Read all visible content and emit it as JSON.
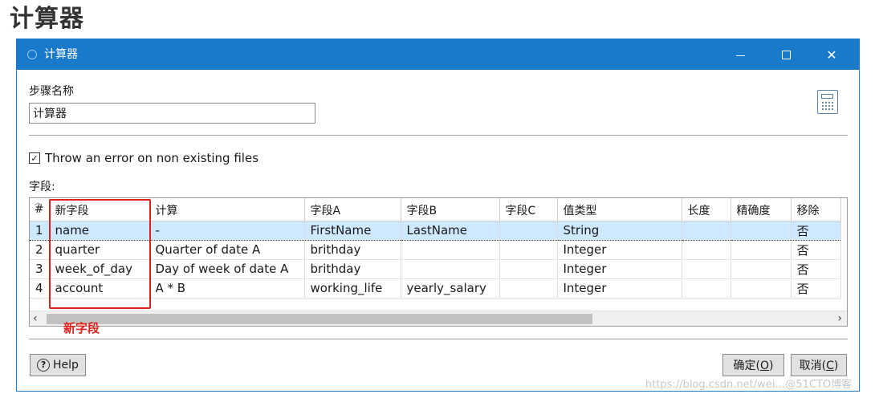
{
  "page_heading": "计算器",
  "window": {
    "title": "计算器",
    "step_name_label": "步骤名称",
    "step_name_value": "计算器",
    "calculator_icon": "calculator-icon"
  },
  "options": {
    "throw_error_label": "Throw an error on non existing files",
    "throw_error_checked": true,
    "checkmark": "✓"
  },
  "fields": {
    "label": "字段:",
    "columns": [
      "#",
      "新字段",
      "计算",
      "字段A",
      "字段B",
      "字段C",
      "值类型",
      "长度",
      "精确度",
      "移除"
    ],
    "rows": [
      [
        "1",
        "name",
        "-",
        "FirstName",
        "LastName",
        "",
        "String",
        "",
        "",
        "否"
      ],
      [
        "2",
        "quarter",
        "Quarter of date A",
        "brithday",
        "",
        "",
        "Integer",
        "",
        "",
        "否"
      ],
      [
        "3",
        "week_of_day",
        "Day of week of date A",
        "brithday",
        "",
        "",
        "Integer",
        "",
        "",
        "否"
      ],
      [
        "4",
        "account",
        "A * B",
        "working_life",
        "yearly_salary",
        "",
        "Integer",
        "",
        "",
        "否"
      ]
    ],
    "selected_row": 1
  },
  "annotation": {
    "caption": "新字段",
    "color": "#e0201c"
  },
  "buttons": {
    "help": "Help",
    "ok_text": "确定(",
    "ok_key": "O",
    "ok_end": ")",
    "cancel_text": "取消(",
    "cancel_key": "C",
    "cancel_end": ")"
  },
  "watermark": "https://blog.csdn.net/wei…@51CTO博客",
  "colors": {
    "titlebar": "#1979ca",
    "selected_row": "#cde8ff"
  }
}
